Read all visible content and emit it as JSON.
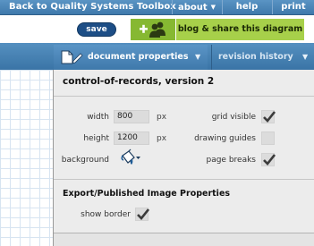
{
  "topbar": {
    "back_link": "Back to Quality Systems Toolbox",
    "menus": [
      {
        "label": "about",
        "has_caret": true
      },
      {
        "label": "help",
        "has_caret": false
      },
      {
        "label": "print",
        "has_caret": false
      }
    ]
  },
  "actions": {
    "save_label": "save",
    "share_label": "blog & share this diagram",
    "share_icon": "add-users-icon"
  },
  "toolbar": {
    "document_properties_label": "document properties",
    "revision_history_label": "revision history"
  },
  "panel": {
    "title": "control-of-records, version 2",
    "width_label": "width",
    "width_value": "800",
    "height_label": "height",
    "height_value": "1200",
    "unit": "px",
    "background_label": "background",
    "grid_visible_label": "grid visible",
    "grid_visible": true,
    "drawing_guides_label": "drawing guides",
    "drawing_guides": false,
    "page_breaks_label": "page breaks",
    "page_breaks": true,
    "export_title": "Export/Published Image Properties",
    "show_border_label": "show border",
    "show_border": true
  },
  "colors": {
    "topbar": "#3f79ab",
    "save_button": "#1d4e86",
    "share_button": "#a7d04a",
    "share_icon_bg": "#86b832",
    "panel_bg": "#ececec",
    "grid_line": "#d7e4f1"
  }
}
